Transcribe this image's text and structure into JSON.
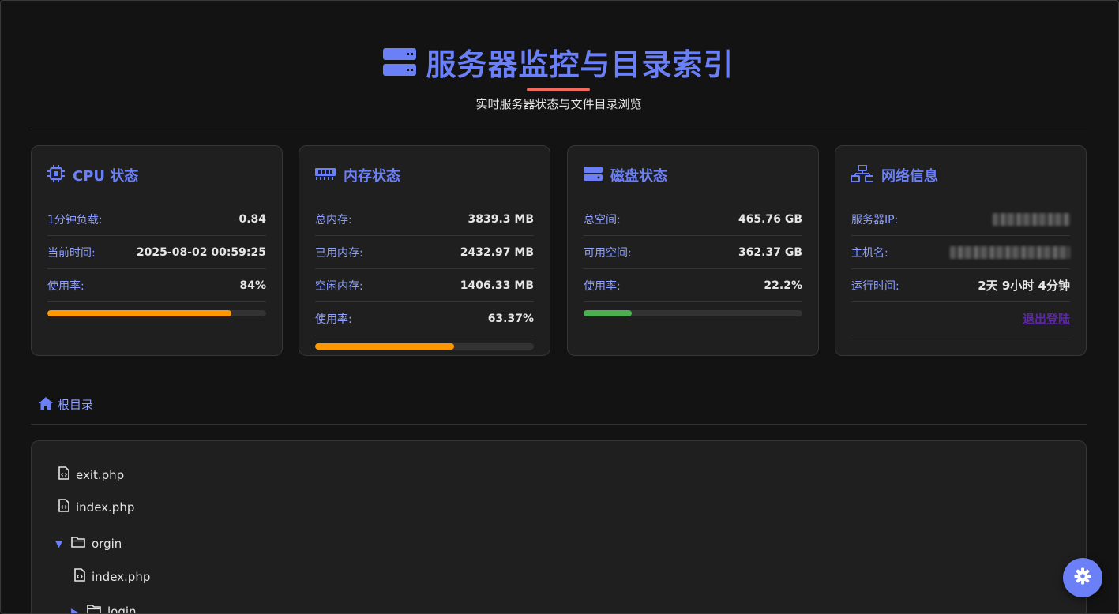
{
  "header": {
    "title": "服务器监控与目录索引",
    "subtitle": "实时服务器状态与文件目录浏览"
  },
  "cards": {
    "cpu": {
      "title": "CPU 状态",
      "rows": [
        {
          "label": "1分钟负载:",
          "value": "0.84"
        },
        {
          "label": "当前时间:",
          "value": "2025-08-02 00:59:25"
        },
        {
          "label": "使用率:",
          "value": "84%"
        }
      ],
      "usage_fraction": 0.84,
      "bar_color": "#ff9800"
    },
    "memory": {
      "title": "内存状态",
      "rows": [
        {
          "label": "总内存:",
          "value": "3839.3 MB"
        },
        {
          "label": "已用内存:",
          "value": "2432.97 MB"
        },
        {
          "label": "空闲内存:",
          "value": "1406.33 MB"
        },
        {
          "label": "使用率:",
          "value": "63.37%"
        }
      ],
      "usage_fraction": 0.6337,
      "bar_color": "#ff9800"
    },
    "disk": {
      "title": "磁盘状态",
      "rows": [
        {
          "label": "总空间:",
          "value": "465.76 GB"
        },
        {
          "label": "可用空间:",
          "value": "362.37 GB"
        },
        {
          "label": "使用率:",
          "value": "22.2%"
        }
      ],
      "usage_fraction": 0.222,
      "bar_color": "#4caf50"
    },
    "network": {
      "title": "网络信息",
      "rows": [
        {
          "label": "服务器IP:",
          "value": ""
        },
        {
          "label": "主机名:",
          "value": ""
        },
        {
          "label": "运行时间:",
          "value": "2天 9小时 4分钟"
        }
      ],
      "logout_label": "退出登陆"
    }
  },
  "breadcrumb": {
    "root_label": "根目录"
  },
  "tree": {
    "items": [
      {
        "type": "file",
        "name": "exit.php"
      },
      {
        "type": "file",
        "name": "index.php"
      },
      {
        "type": "folder",
        "name": "orgin",
        "expanded": true
      },
      {
        "type": "file",
        "name": "index.php",
        "parent": "orgin"
      },
      {
        "type": "folder",
        "name": "login",
        "expanded": false,
        "parent": "orgin"
      }
    ]
  },
  "colors": {
    "accent": "#6b7ff7",
    "label": "#8fa0ff",
    "background": "#131313",
    "card": "#1f1f1f",
    "warning": "#ff9800",
    "ok": "#4caf50",
    "title_underline": "#f26a5b"
  },
  "icons": {
    "title": "server-icon",
    "cpu": "microchip-icon",
    "memory": "memory-icon",
    "disk": "hdd-icon",
    "network": "network-icon",
    "breadcrumb": "home-icon",
    "file": "code-file-icon",
    "folder": "folder-icon",
    "settings": "gear-icon"
  }
}
